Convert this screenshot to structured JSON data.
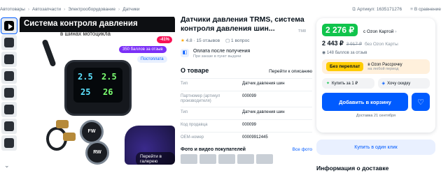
{
  "breadcrumbs": [
    "Автотовары",
    "Автозапчасти",
    "Электрооборудование",
    "Датчики"
  ],
  "topright": {
    "article": "Артикул: 1635171276",
    "compare": "В сравнение"
  },
  "gallery": {
    "banner": "Система контроля давления",
    "sub_banner": "в шинах мотоцикла",
    "discount": "-41%",
    "bonus": "350 баллов за отзыв",
    "postavka": "Постоплата",
    "num1": "2.5",
    "num2": "2.5",
    "num3": "25",
    "num4": "26",
    "sensor1": "FW",
    "sensor2": "RW",
    "open_gallery": "Перейти в галерею"
  },
  "product": {
    "title": "Датчики давления TRMS, система контроля давления шин...",
    "brand_tag": "ТМ8",
    "rating": "4.8",
    "reviews": "15 отзывов",
    "questions": "1 вопрос",
    "pay_title": "Оплата после получения",
    "pay_sub": "При заказе в пункт выдачи",
    "about_title": "О товаре",
    "about_link": "Перейти к описанию",
    "specs": [
      {
        "k": "Тип",
        "v": "Датчик давления шин"
      },
      {
        "k": "Партномер (артикул производителя)",
        "v": "000099"
      },
      {
        "k": "Тип",
        "v": "Датчик давления шин"
      },
      {
        "k": "Код продавца",
        "v": "000099"
      },
      {
        "k": "OEM-номер",
        "v": "00009912445"
      }
    ],
    "photos_title": "Фото и видео покупателей",
    "photos_link": "Все фото"
  },
  "buy": {
    "price_card": "2 276 ₽",
    "card_label": "с Ozon Картой",
    "price_regular": "2 443 ₽",
    "price_old": "3 917 ₽",
    "regular_label": "без Ozon Карты",
    "reviews_line": "148 баллов за отзыв",
    "installment_label": "Без переплат",
    "installment_t1": "в Ozon Рассрочку",
    "installment_t2": "на любой период",
    "btn_sbp": "Купить за 1 ₽",
    "btn_discount": "Хочу скидку",
    "cart": "Добавить в корзину",
    "delivery": "Доставка 21 сентября",
    "oneclick": "Купить в один клик",
    "delivery_info": "Информация о доставке"
  },
  "colors": {
    "accent": "#005bff",
    "green": "#10c44c",
    "discount": "#f91155"
  }
}
